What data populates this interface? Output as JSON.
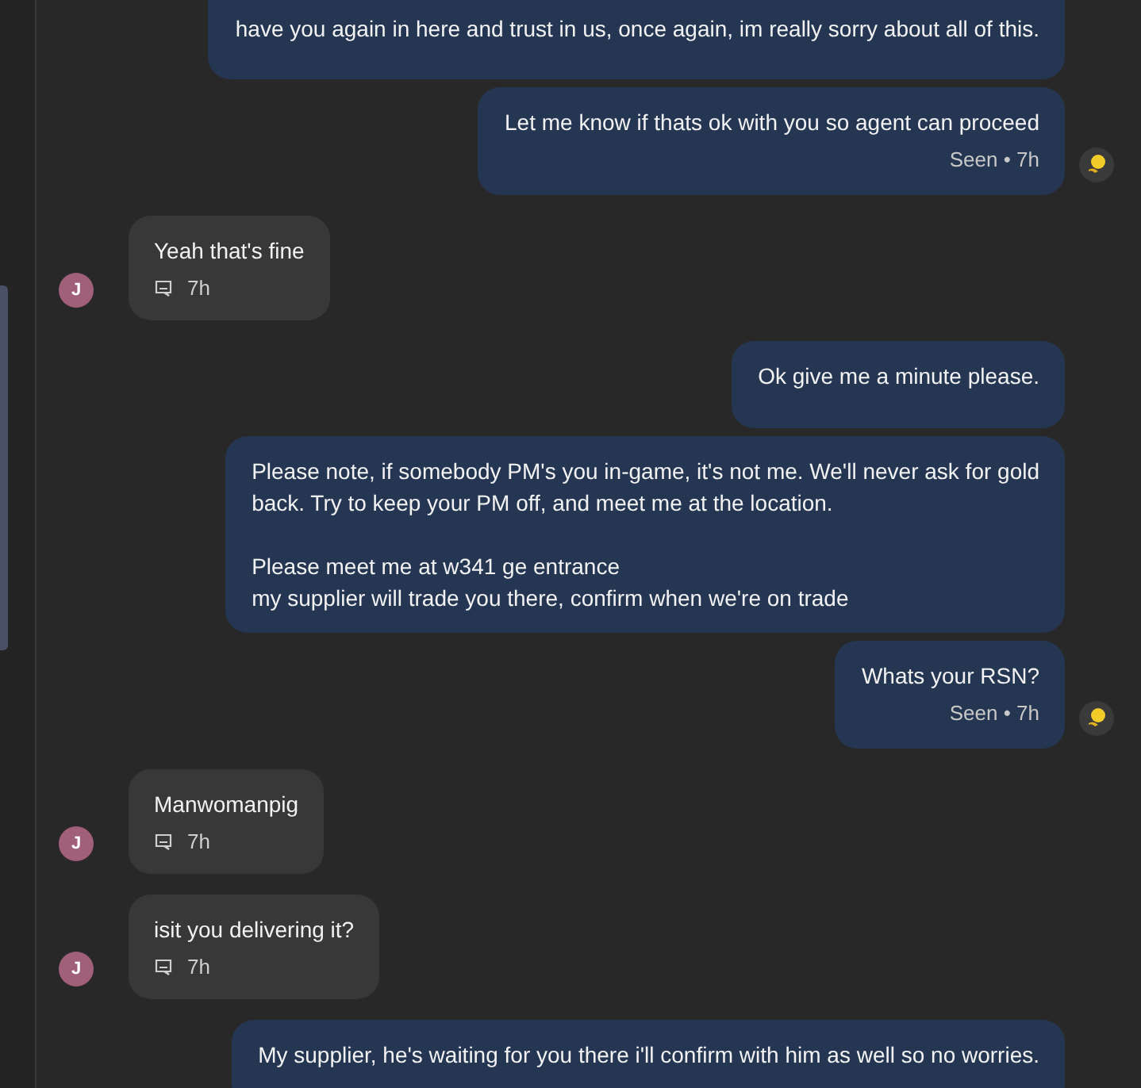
{
  "messages": [
    {
      "kind": "out",
      "paragraphs": [
        "have you again in here and trust in us, once again, im really sorry about all of this."
      ],
      "clipped": true
    },
    {
      "kind": "out",
      "paragraphs": [
        "Let me know if thats ok with you so agent can proceed"
      ],
      "status": "Seen • 7h"
    },
    {
      "kind": "in",
      "paragraphs": [
        "Yeah that's fine"
      ],
      "time": "7h",
      "avatar": "J"
    },
    {
      "kind": "out",
      "paragraphs": [
        "Ok give me a minute please."
      ]
    },
    {
      "kind": "out",
      "paragraphs": [
        "Please note, if somebody PM's you in-game, it's not me. We'll never ask for gold\nback. Try to keep your PM off, and meet me at the location.",
        "Please meet me at w341 ge entrance\nmy supplier will trade you there, confirm when we're on trade"
      ]
    },
    {
      "kind": "out",
      "paragraphs": [
        "Whats your RSN?"
      ],
      "status": "Seen • 7h"
    },
    {
      "kind": "in",
      "paragraphs": [
        "Manwomanpig"
      ],
      "time": "7h",
      "avatar": "J"
    },
    {
      "kind": "in",
      "paragraphs": [
        "isit you delivering it?"
      ],
      "time": "7h",
      "avatar": "J"
    },
    {
      "kind": "out",
      "paragraphs": [
        "My supplier, he's waiting for you there i'll confirm with him as well so no worries."
      ]
    }
  ]
}
